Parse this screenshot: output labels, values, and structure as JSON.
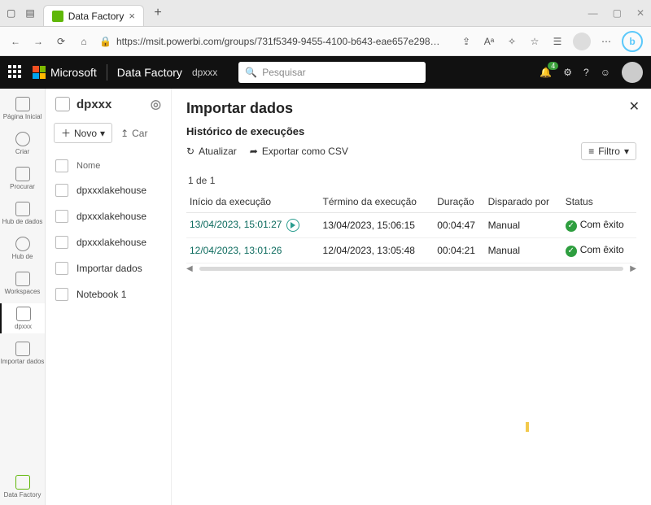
{
  "browser": {
    "tab_title": "Data Factory",
    "url": "https://msit.powerbi.com/groups/731f5349-9455-4100-b643-eae657e298…"
  },
  "appbar": {
    "brand": "Microsoft",
    "product": "Data Factory",
    "workspace": "dpxxx",
    "search_placeholder": "Pesquisar",
    "notification_count": "4"
  },
  "rail": {
    "items": [
      {
        "label": "Página Inicial"
      },
      {
        "label": "Criar"
      },
      {
        "label": "Procurar"
      },
      {
        "label": "Hub de dados"
      },
      {
        "label": "Hub de"
      },
      {
        "label": "Workspaces"
      },
      {
        "label": "dpxxx"
      },
      {
        "label": "Importar dados"
      }
    ],
    "bottom_label": "Data Factory"
  },
  "workspace_panel": {
    "title": "dpxxx",
    "new_label": "Novo",
    "upload_label": "Car",
    "col_name": "Nome",
    "items": [
      {
        "name": "dpxxxlakehouse"
      },
      {
        "name": "dpxxxlakehouse"
      },
      {
        "name": "dpxxxlakehouse"
      },
      {
        "name": "Importar dados"
      },
      {
        "name": "Notebook 1"
      }
    ]
  },
  "detail": {
    "title": "Importar dados",
    "subtitle": "Histórico de execuções",
    "refresh_label": "Atualizar",
    "export_label": "Exportar como CSV",
    "filter_label": "Filtro",
    "count_label": "1 de 1",
    "columns": {
      "start": "Início da execução",
      "end": "Término da execução",
      "duration": "Duração",
      "trigger": "Disparado por",
      "status": "Status"
    },
    "rows": [
      {
        "start": "13/04/2023, 15:01:27",
        "end": "13/04/2023, 15:06:15",
        "duration": "00:04:47",
        "trigger": "Manual",
        "status": "Com êxito",
        "running": true
      },
      {
        "start": "12/04/2023, 13:01:26",
        "end": "12/04/2023, 13:05:48",
        "duration": "00:04:21",
        "trigger": "Manual",
        "status": "Com êxito",
        "running": false
      }
    ]
  }
}
